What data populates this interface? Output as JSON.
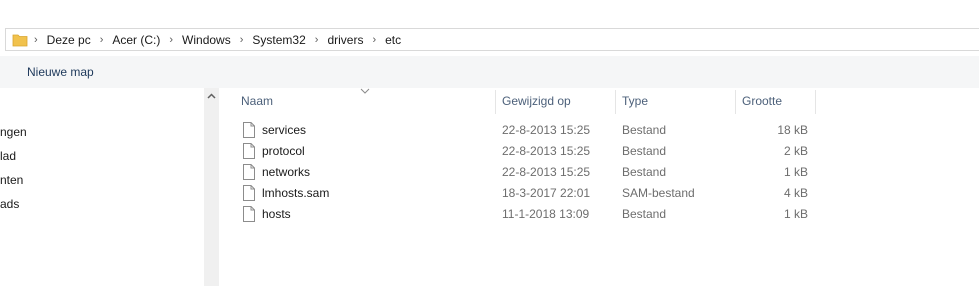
{
  "breadcrumb": {
    "items": [
      "Deze pc",
      "Acer (C:)",
      "Windows",
      "System32",
      "drivers",
      "etc"
    ]
  },
  "command_bar": {
    "new_folder_label": "Nieuwe map"
  },
  "nav_pane": {
    "items": [
      "ngen",
      "lad",
      "nten",
      "ads"
    ]
  },
  "columns": {
    "name": "Naam",
    "modified": "Gewijzigd op",
    "type": "Type",
    "size": "Grootte"
  },
  "files": [
    {
      "name": "services",
      "modified": "22-8-2013 15:25",
      "type": "Bestand",
      "size": "18 kB"
    },
    {
      "name": "protocol",
      "modified": "22-8-2013 15:25",
      "type": "Bestand",
      "size": "2 kB"
    },
    {
      "name": "networks",
      "modified": "22-8-2013 15:25",
      "type": "Bestand",
      "size": "1 kB"
    },
    {
      "name": "lmhosts.sam",
      "modified": "18-3-2017 22:01",
      "type": "SAM-bestand",
      "size": "4 kB"
    },
    {
      "name": "hosts",
      "modified": "11-1-2018 13:09",
      "type": "Bestand",
      "size": "1 kB"
    }
  ],
  "colors": {
    "folder": "#f1c24d",
    "header_text": "#4c607a",
    "secondary_text": "#6d6d6d",
    "command_bar_bg": "#f5f6f7"
  },
  "icons": {
    "address": "folder-icon",
    "separator": "chevron-right-icon",
    "file": "file-icon",
    "sort": "chevron-down-icon",
    "scroll_up": "chevron-up-icon"
  }
}
